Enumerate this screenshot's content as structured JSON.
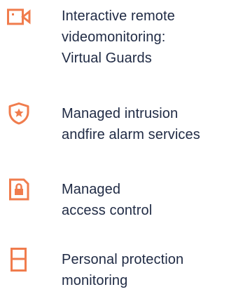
{
  "accent_color": "#f07c4d",
  "text_color": "#1f2a44",
  "services": [
    {
      "icon": "video-camera-icon",
      "lines": [
        "Interactive remote",
        "videomonitoring:",
        "Virtual Guards"
      ]
    },
    {
      "icon": "shield-star-icon",
      "lines": [
        "Managed intrusion",
        "andfire alarm services"
      ]
    },
    {
      "icon": "lock-document-icon",
      "lines": [
        "Managed",
        "access control"
      ]
    },
    {
      "icon": "personal-device-icon",
      "lines": [
        "Personal protection",
        "monitoring"
      ]
    }
  ]
}
